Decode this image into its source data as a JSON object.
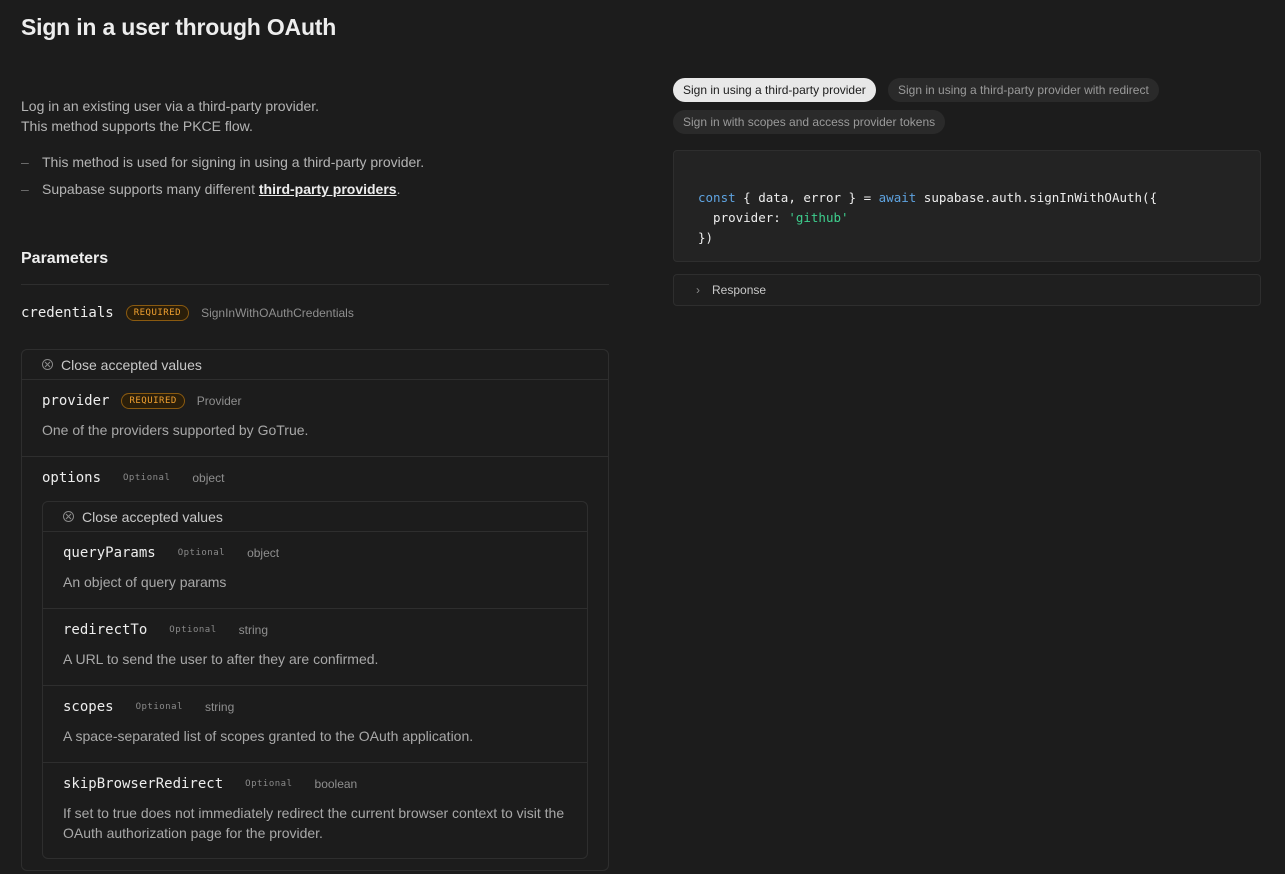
{
  "title": "Sign in a user through OAuth",
  "intro": {
    "line1": "Log in an existing user via a third-party provider.",
    "line2": "This method supports the PKCE flow."
  },
  "notes": [
    {
      "text": "This method is used for signing in using a third-party provider."
    },
    {
      "prefix": "Supabase supports many different ",
      "link": "third-party providers",
      "suffix": "."
    }
  ],
  "parameters_title": "Parameters",
  "credentials": {
    "name": "credentials",
    "badge": "REQUIRED",
    "type": "SignInWithOAuthCredentials"
  },
  "close_label": "Close accepted values",
  "provider": {
    "name": "provider",
    "badge": "REQUIRED",
    "type": "Provider",
    "description": "One of the providers supported by GoTrue."
  },
  "options": {
    "name": "options",
    "badge": "Optional",
    "type": "object"
  },
  "option_params": [
    {
      "name": "queryParams",
      "badge": "Optional",
      "type": "object",
      "description": "An object of query params"
    },
    {
      "name": "redirectTo",
      "badge": "Optional",
      "type": "string",
      "description": "A URL to send the user to after they are confirmed."
    },
    {
      "name": "scopes",
      "badge": "Optional",
      "type": "string",
      "description": "A space-separated list of scopes granted to the OAuth application."
    },
    {
      "name": "skipBrowserRedirect",
      "badge": "Optional",
      "type": "boolean",
      "description": "If set to true does not immediately redirect the current browser context to visit the OAuth authorization page for the provider."
    }
  ],
  "example_tabs": [
    {
      "label": "Sign in using a third-party provider",
      "active": true
    },
    {
      "label": "Sign in using a third-party provider with redirect",
      "active": false
    },
    {
      "label": "Sign in with scopes and access provider tokens",
      "active": false
    }
  ],
  "code": {
    "l1_a": "const",
    "l1_b": " { data, error } = ",
    "l1_c": "await",
    "l1_d": " supabase.auth.signInWithOAuth({",
    "l2_a": "  provider: ",
    "l2_b": "'github'",
    "l3": "})"
  },
  "response_label": "Response",
  "colors": {
    "background": "#1c1c1c",
    "required": "#f0a030",
    "keyword": "#5ea3e0",
    "string": "#3ecf8e"
  }
}
